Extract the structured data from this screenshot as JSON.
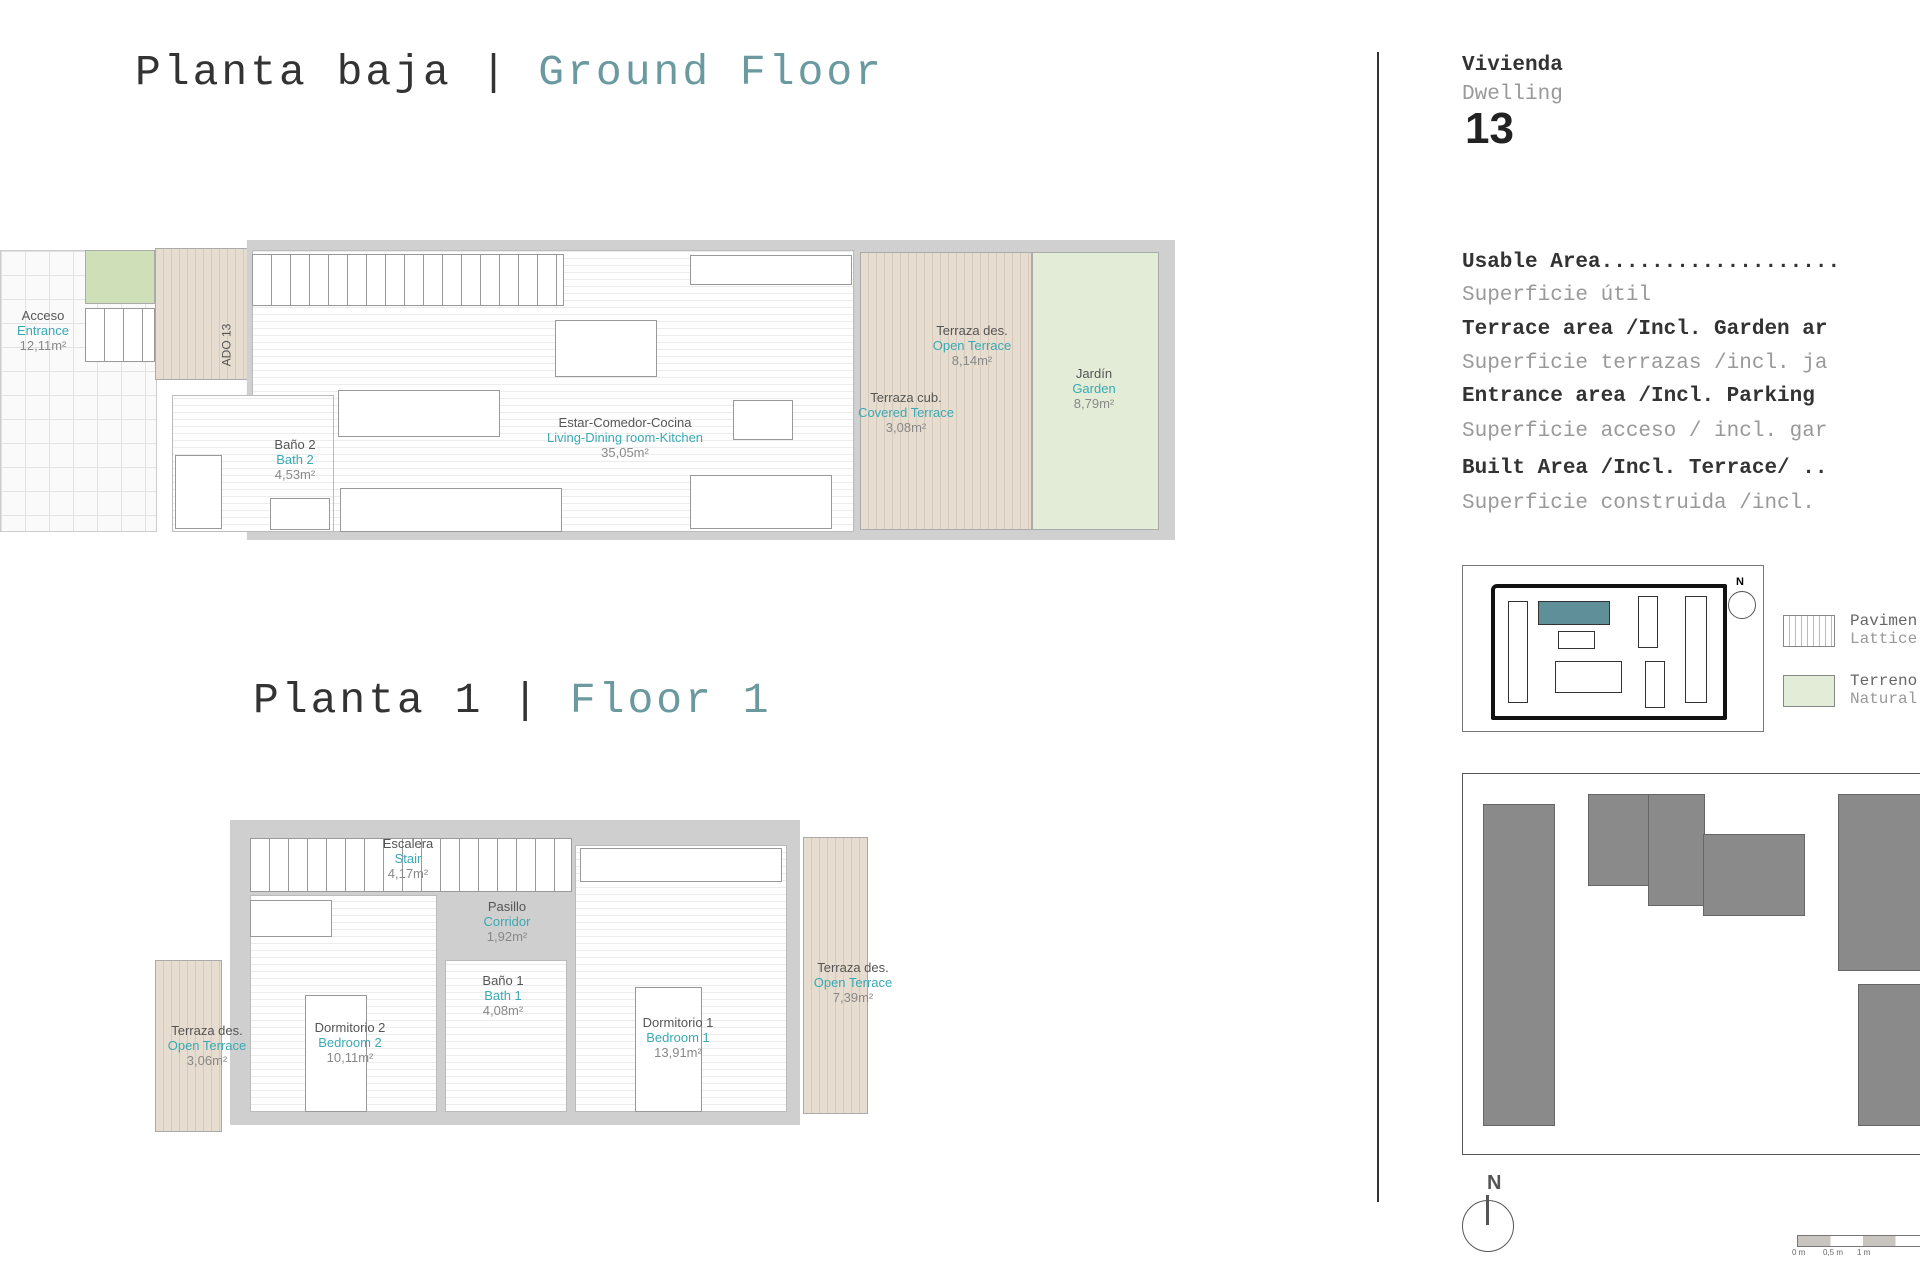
{
  "ground_floor": {
    "title_es": "Planta baja",
    "separator": "|",
    "title_en": "Ground Floor",
    "door_label": "ADO 13",
    "rooms": [
      {
        "es": "Acceso",
        "en": "Entrance",
        "area": "12,11m²"
      },
      {
        "es": "Baño 2",
        "en": "Bath 2",
        "area": "4,53m²"
      },
      {
        "es": "Estar-Comedor-Cocina",
        "en": "Living-Dining room-Kitchen",
        "area": "35,05m²"
      },
      {
        "es": "Terraza des.",
        "en": "Open Terrace",
        "area": "8,14m²"
      },
      {
        "es": "Terraza cub.",
        "en": "Covered Terrace",
        "area": "3,08m²"
      },
      {
        "es": "Jardín",
        "en": "Garden",
        "area": "8,79m²"
      }
    ]
  },
  "floor_1": {
    "title_es": "Planta 1",
    "separator": "|",
    "title_en": "Floor 1",
    "rooms": [
      {
        "es": "Escalera",
        "en": "Stair",
        "area": "4,17m²"
      },
      {
        "es": "Pasillo",
        "en": "Corridor",
        "area": "1,92m²"
      },
      {
        "es": "Baño 1",
        "en": "Bath 1",
        "area": "4,08m²"
      },
      {
        "es": "Dormitorio 2",
        "en": "Bedroom 2",
        "area": "10,11m²"
      },
      {
        "es": "Dormitorio 1",
        "en": "Bedroom 1",
        "area": "13,91m²"
      },
      {
        "es": "Terraza des.",
        "en": "Open Terrace",
        "area": "3,06m²"
      },
      {
        "es": "Terraza des.",
        "en": "Open Terrace",
        "area": "7,39m²"
      }
    ]
  },
  "dwelling": {
    "label_es": "Vivienda",
    "label_en": "Dwelling",
    "number": "13"
  },
  "areas": [
    {
      "en": "Usable Area...................",
      "es": "Superficie útil"
    },
    {
      "en": "Terrace area /Incl. Garden ar",
      "es": "Superficie terrazas /incl. ja"
    },
    {
      "en": "Entrance area /Incl. Parking",
      "es": "Superficie acceso / incl. gar"
    },
    {
      "en": "Built Area /Incl. Terrace/ ..",
      "es": "Superficie construida /incl."
    }
  ],
  "legend": [
    {
      "es": "Pavimen",
      "en": "Lattice"
    },
    {
      "es": "Terreno",
      "en": "Natural"
    }
  ],
  "north_label": "N",
  "scale_bar": [
    "0 m",
    "0,5 m",
    "1 m"
  ],
  "colors": {
    "accent_teal": "#3aa9b4",
    "title_teal": "#6a9aa0",
    "highlight_block": "#5f8f98",
    "garden": "#e3ecd6",
    "deck": "#e0d6c8"
  }
}
